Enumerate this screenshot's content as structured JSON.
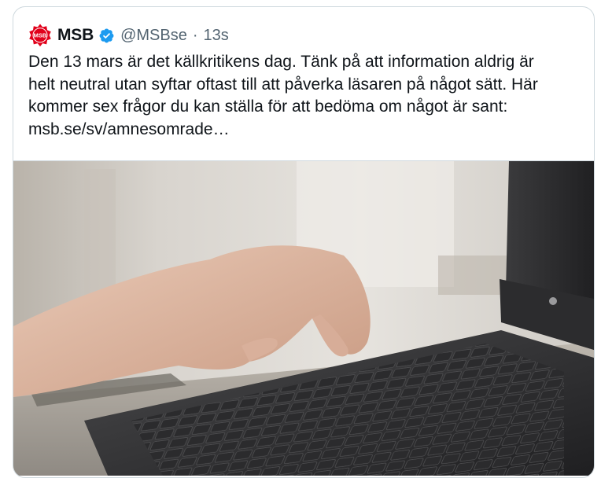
{
  "tweet": {
    "author": {
      "name": "MSB",
      "handle": "@MSBse",
      "verified": true,
      "avatar_text": "MSB",
      "avatar_color": "#e1001a"
    },
    "separator": "·",
    "timestamp": "13s",
    "text_lines": [
      "Den 13 mars är det källkritikens dag. Tänk på att information aldrig är",
      "helt neutral utan syftar oftast till att påverka läsaren på något sätt. Här",
      "kommer sex frågor du kan ställa för att bedöma om något är sant:"
    ],
    "link_text": "msb.se/sv/amnesomrade…",
    "media": {
      "description_icon": "photo-hand-typing-on-laptop-keyboard"
    }
  },
  "colors": {
    "text_primary": "#0f1419",
    "text_secondary": "#536471",
    "verified_blue": "#1d9bf0",
    "border": "#cfd9de",
    "brand_red": "#e1001a"
  }
}
